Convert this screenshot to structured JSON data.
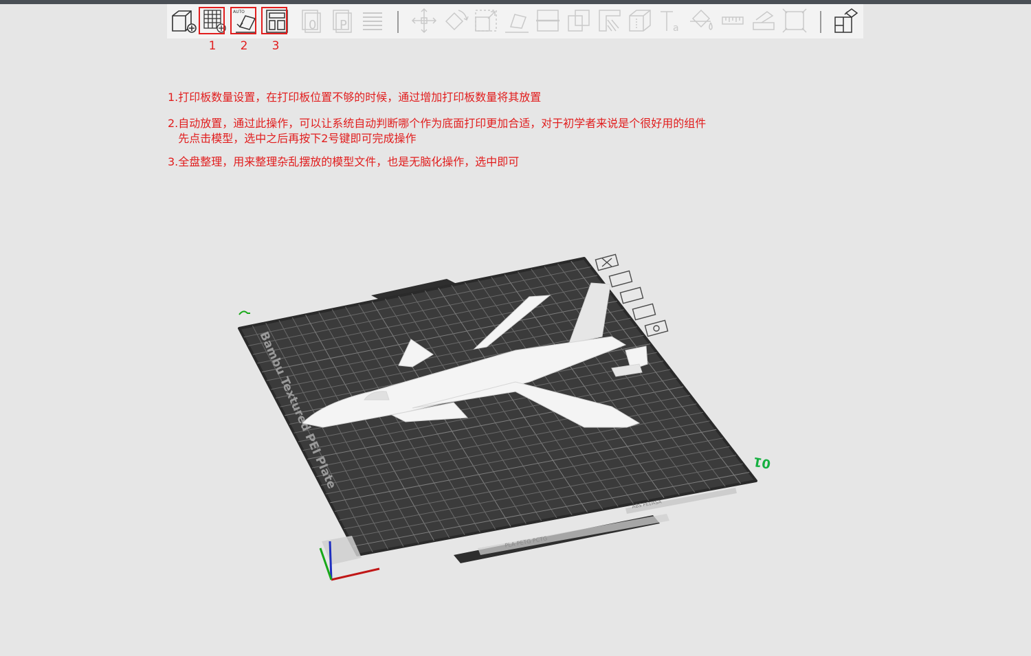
{
  "toolbar": {
    "items": [
      {
        "name": "add-object-icon",
        "label": "Add object"
      },
      {
        "name": "plate-grid-add-icon",
        "label": "Add plate"
      },
      {
        "name": "auto-orient-icon",
        "label": "Auto orient"
      },
      {
        "name": "arrange-icon",
        "label": "Arrange all"
      },
      {
        "name": "copy-icon",
        "label": "Copy"
      },
      {
        "name": "paste-icon",
        "label": "Paste"
      },
      {
        "name": "layers-icon",
        "label": "Layers"
      },
      {
        "name": "move-icon",
        "label": "Move"
      },
      {
        "name": "rotate-icon",
        "label": "Rotate"
      },
      {
        "name": "scale-icon",
        "label": "Scale"
      },
      {
        "name": "lay-on-face-icon",
        "label": "Lay on face"
      },
      {
        "name": "cut-icon",
        "label": "Cut"
      },
      {
        "name": "boolean-icon",
        "label": "Boolean"
      },
      {
        "name": "support-paint-icon",
        "label": "Support painting"
      },
      {
        "name": "seam-paint-icon",
        "label": "Seam painting"
      },
      {
        "name": "text-emboss-icon",
        "label": "Text"
      },
      {
        "name": "color-paint-icon",
        "label": "Color painting"
      },
      {
        "name": "measure-icon",
        "label": "Measure"
      },
      {
        "name": "assembly-icon",
        "label": "Assembly"
      },
      {
        "name": "fit-view-icon",
        "label": "Fit view"
      },
      {
        "name": "split-parts-icon",
        "label": "Split to parts"
      }
    ]
  },
  "callouts": {
    "numbers": [
      "1",
      "2",
      "3"
    ],
    "notes": [
      "1.打印板数量设置，在打印板位置不够的时候，通过增加打印板数量将其放置",
      "2.自动放置，通过此操作，可以让系统自动判断哪个作为底面打印更加合适，对于初学者来说是个很好用的组件",
      "   先点击模型，选中之后再按下2号键即可完成操作",
      "3.全盘整理，用来整理杂乱摆放的模型文件，也是无脑化操作，选中即可"
    ]
  },
  "plate": {
    "name": "Bambu Textured PEI Plate",
    "index": "01",
    "bottom_label": "PLA PETG PCTG",
    "right_label": "ABS PEI/ASA",
    "colors": {
      "plate": "#3b3b3b",
      "grid": "#6a6a6a",
      "model": "#f4f4f4",
      "index": "#15b040"
    }
  }
}
